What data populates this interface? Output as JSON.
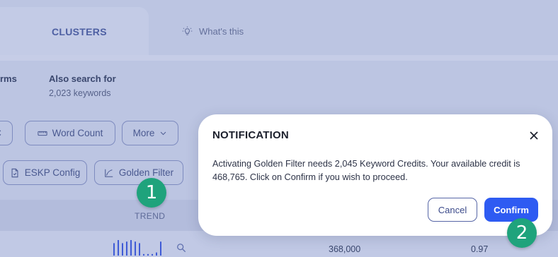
{
  "tabs": {
    "clusters_label": "CLUSTERS",
    "whats_this_label": "What's this"
  },
  "stats": {
    "partial_label": "rms",
    "also_search_title": "Also search for",
    "also_search_count": "2,023 keywords"
  },
  "filters": {
    "partial_chip": "C",
    "word_count": "Word Count",
    "more": "More",
    "eskp_config": "ESKP Config",
    "golden_filter": "Golden Filter"
  },
  "table": {
    "trend_header": "TREND",
    "row": {
      "volume": "368,000",
      "cpc": "0.97",
      "trend_values": [
        8,
        10,
        8,
        9,
        10,
        9,
        8,
        1,
        1,
        1,
        2,
        9
      ]
    }
  },
  "modal": {
    "title": "NOTIFICATION",
    "body": "Activating Golden Filter needs 2,045 Keyword Credits. Your available credit is 468,765. Click on Confirm if you wish to proceed.",
    "cancel_label": "Cancel",
    "confirm_label": "Confirm"
  },
  "badges": {
    "step1": "1",
    "step2": "2"
  },
  "colors": {
    "accent": "#2e5bf2",
    "badge": "#1fa37c",
    "overlay_bg": "#bcc5e2"
  },
  "icons": [
    "lightbulb-icon",
    "ruler-icon",
    "chevron-down-icon",
    "document-icon",
    "chart-icon",
    "search-icon",
    "close-icon"
  ]
}
